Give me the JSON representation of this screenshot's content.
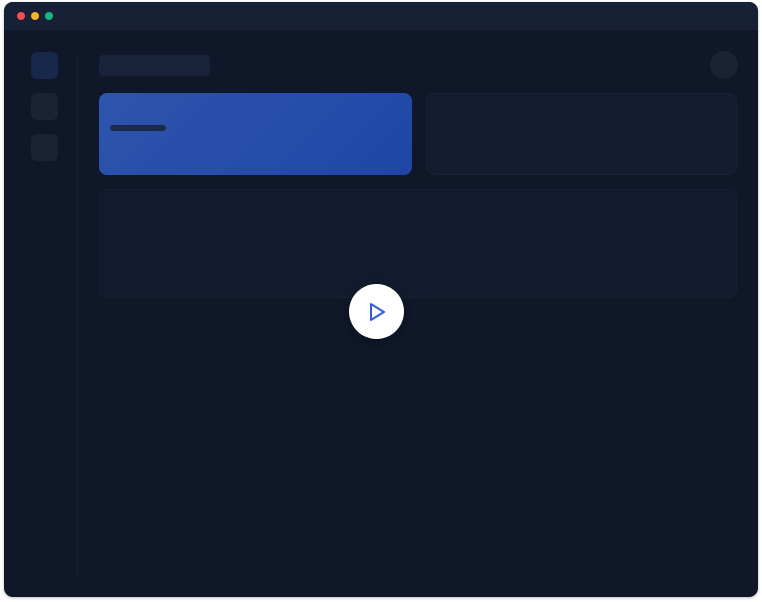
{
  "window": {
    "controls": [
      "close-icon",
      "minimize-icon",
      "maximize-icon"
    ]
  },
  "colors": {
    "window_bg": "#0f1728",
    "titlebar_bg": "#172135",
    "accent_card_gradient_start": "#2d55ac",
    "accent_card_gradient_end": "#1e46a7",
    "play_icon": "#2f5fd8",
    "close": "#f04f4f",
    "minimize": "#f5b325",
    "maximize": "#18b982"
  },
  "sidebar": {
    "items": [
      "sidebar-item-1",
      "sidebar-item-2",
      "sidebar-item-3"
    ]
  },
  "overlay": {
    "play_icon": "play-icon"
  }
}
